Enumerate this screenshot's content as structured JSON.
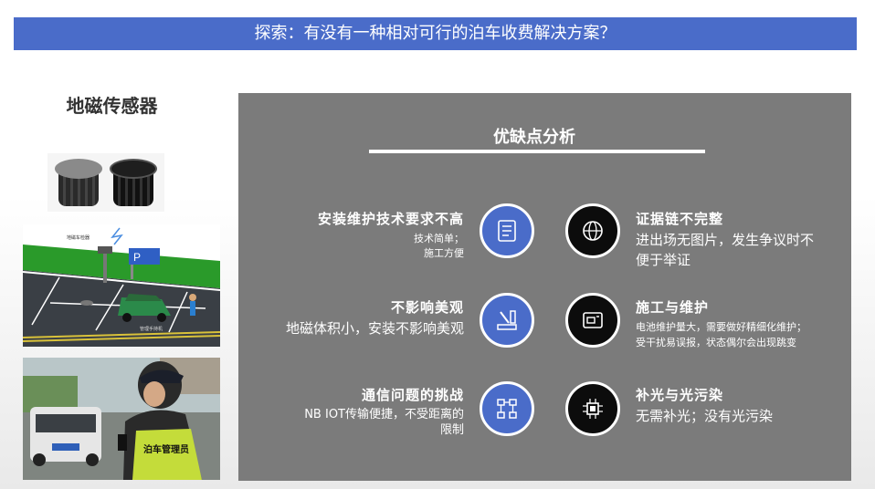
{
  "header": {
    "title": "探索：有没有一种相对可行的泊车收费解决方案？"
  },
  "left": {
    "sensor_title": "地磁传感器",
    "diagram": {
      "p_sign": "P",
      "label_top": "地磁车检器",
      "label_bottom": "管理手持机"
    },
    "photo": {
      "vest_text": "泊车管理员"
    }
  },
  "panel": {
    "title": "优缺点分析",
    "items": [
      {
        "heading": "安装维护技术要求不高",
        "desc1": "技术简单；",
        "desc2": "施工方便",
        "icon": "document-list-icon"
      },
      {
        "heading": "不影响美观",
        "desc1": "地磁体积小，安装不影响美观",
        "icon": "tools-icon"
      },
      {
        "heading": "通信问题的挑战",
        "desc1": "NB IOT传输便捷，不受距离的",
        "desc2": "限制",
        "icon": "network-icon"
      },
      {
        "heading": "证据链不完整",
        "desc1": "进出场无图片，发生争议时不",
        "desc2": "便于举证",
        "icon": "globe-icon"
      },
      {
        "heading": "施工与维护",
        "desc1": "电池维护量大，需要做好精细化维护；",
        "desc2": "受干扰易误报，状态偶尔会出现跳变",
        "icon": "wallet-card-icon"
      },
      {
        "heading": "补光与光污染",
        "desc1": "无需补光；没有光污染",
        "icon": "chip-icon"
      }
    ]
  },
  "colors": {
    "header_bg": "#4a6cc9",
    "panel_bg": "#7b7b7b",
    "blue_circle": "#4a6cc9",
    "black_circle": "#0c0c0c"
  }
}
